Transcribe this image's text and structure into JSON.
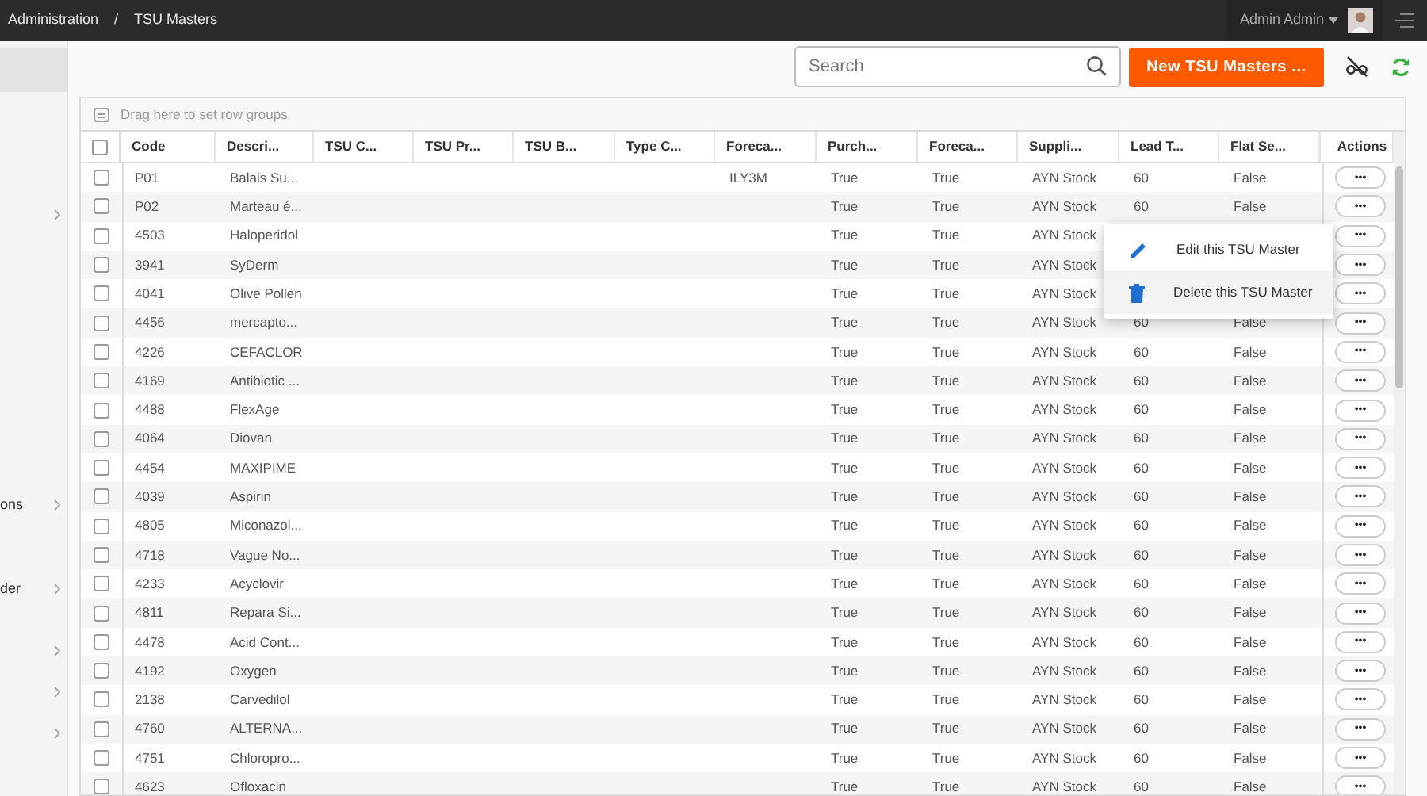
{
  "breadcrumb": [
    "Administration",
    "/",
    "TSU Masters"
  ],
  "user": {
    "name": "Admin Admin"
  },
  "sidebar": {
    "items": [
      {
        "selected": true,
        "expandable": false
      },
      {
        "selected": false,
        "expandable": true
      },
      {
        "label": "ons",
        "selected": false,
        "expandable": true
      },
      {
        "label": "der",
        "selected": false,
        "expandable": true
      },
      {
        "selected": false,
        "expandable": true
      },
      {
        "selected": false,
        "expandable": true
      },
      {
        "selected": false,
        "expandable": true
      }
    ]
  },
  "search": {
    "placeholder": "Search"
  },
  "new_button": "New TSU Masters ...",
  "grid": {
    "group_hint": "Drag here to set row groups",
    "select_all_checked": false,
    "columns": [
      "Code",
      "Descri...",
      "TSU C...",
      "TSU Pr...",
      "TSU B...",
      "Type C...",
      "Foreca...",
      "Purch...",
      "Foreca...",
      "Suppli...",
      "Lead T...",
      "Flat Se...",
      "Actions"
    ],
    "rows": [
      {
        "checked": false,
        "code": "P01",
        "description": "Balais Su...",
        "forecast": "ILY3M",
        "purchase": "True",
        "forecast_2": "True",
        "supplier": "AYN Stock",
        "lead": "60",
        "flat": "False",
        "action": "•••"
      },
      {
        "checked": false,
        "code": "P02",
        "description": "Marteau é...",
        "purchase": "True",
        "forecast_2": "True",
        "supplier": "AYN Stock",
        "lead": "60",
        "flat": "False",
        "action": "•••"
      },
      {
        "checked": false,
        "code": "4503",
        "description": "Haloperidol",
        "purchase": "True",
        "forecast_2": "True",
        "supplier": "AYN Stock",
        "action": "•••"
      },
      {
        "checked": false,
        "code": "3941",
        "description": "SyDerm",
        "purchase": "True",
        "forecast_2": "True",
        "supplier": "AYN Stock",
        "action": "•••"
      },
      {
        "checked": false,
        "code": "4041",
        "description": "Olive Pollen",
        "purchase": "True",
        "forecast_2": "True",
        "supplier": "AYN Stock",
        "action": "•••"
      },
      {
        "checked": false,
        "code": "4456",
        "description": "mercapto...",
        "purchase": "True",
        "forecast_2": "True",
        "supplier": "AYN Stock",
        "lead": "60",
        "flat": "False",
        "action": "•••"
      },
      {
        "checked": false,
        "code": "4226",
        "description": "CEFACLOR",
        "purchase": "True",
        "forecast_2": "True",
        "supplier": "AYN Stock",
        "lead": "60",
        "flat": "False",
        "action": "•••"
      },
      {
        "checked": false,
        "code": "4169",
        "description": "Antibiotic ...",
        "purchase": "True",
        "forecast_2": "True",
        "supplier": "AYN Stock",
        "lead": "60",
        "flat": "False",
        "action": "•••"
      },
      {
        "checked": false,
        "code": "4488",
        "description": "FlexAge",
        "purchase": "True",
        "forecast_2": "True",
        "supplier": "AYN Stock",
        "lead": "60",
        "flat": "False",
        "action": "•••"
      },
      {
        "checked": false,
        "code": "4064",
        "description": "Diovan",
        "purchase": "True",
        "forecast_2": "True",
        "supplier": "AYN Stock",
        "lead": "60",
        "flat": "False",
        "action": "•••"
      },
      {
        "checked": false,
        "code": "4454",
        "description": "MAXIPIME",
        "purchase": "True",
        "forecast_2": "True",
        "supplier": "AYN Stock",
        "lead": "60",
        "flat": "False",
        "action": "•••"
      },
      {
        "checked": false,
        "code": "4039",
        "description": "Aspirin",
        "purchase": "True",
        "forecast_2": "True",
        "supplier": "AYN Stock",
        "lead": "60",
        "flat": "False",
        "action": "•••"
      },
      {
        "checked": false,
        "code": "4805",
        "description": "Miconazol...",
        "purchase": "True",
        "forecast_2": "True",
        "supplier": "AYN Stock",
        "lead": "60",
        "flat": "False",
        "action": "•••"
      },
      {
        "checked": false,
        "code": "4718",
        "description": "Vague No...",
        "purchase": "True",
        "forecast_2": "True",
        "supplier": "AYN Stock",
        "lead": "60",
        "flat": "False",
        "action": "•••"
      },
      {
        "checked": false,
        "code": "4233",
        "description": "Acyclovir",
        "purchase": "True",
        "forecast_2": "True",
        "supplier": "AYN Stock",
        "lead": "60",
        "flat": "False",
        "action": "•••"
      },
      {
        "checked": false,
        "code": "4811",
        "description": "Repara Si...",
        "purchase": "True",
        "forecast_2": "True",
        "supplier": "AYN Stock",
        "lead": "60",
        "flat": "False",
        "action": "•••"
      },
      {
        "checked": false,
        "code": "4478",
        "description": "Acid Cont...",
        "purchase": "True",
        "forecast_2": "True",
        "supplier": "AYN Stock",
        "lead": "60",
        "flat": "False",
        "action": "•••"
      },
      {
        "checked": false,
        "code": "4192",
        "description": "Oxygen",
        "purchase": "True",
        "forecast_2": "True",
        "supplier": "AYN Stock",
        "lead": "60",
        "flat": "False",
        "action": "•••"
      },
      {
        "checked": false,
        "code": "2138",
        "description": "Carvedilol",
        "purchase": "True",
        "forecast_2": "True",
        "supplier": "AYN Stock",
        "lead": "60",
        "flat": "False",
        "action": "•••"
      },
      {
        "checked": false,
        "code": "4760",
        "description": "ALTERNA...",
        "purchase": "True",
        "forecast_2": "True",
        "supplier": "AYN Stock",
        "lead": "60",
        "flat": "False",
        "action": "•••"
      },
      {
        "checked": false,
        "code": "4751",
        "description": "Chloropro...",
        "purchase": "True",
        "forecast_2": "True",
        "supplier": "AYN Stock",
        "lead": "60",
        "flat": "False",
        "action": "•••"
      },
      {
        "checked": false,
        "code": "4623",
        "description": "Ofloxacin",
        "purchase": "True",
        "forecast_2": "True",
        "supplier": "AYN Stock",
        "lead": "60",
        "flat": "False",
        "action": "•••"
      }
    ]
  },
  "context_menu": {
    "items": [
      {
        "kind": "edit",
        "label": "Edit this TSU Master",
        "selected": false
      },
      {
        "kind": "delete",
        "label": "Delete this TSU Master",
        "selected": true
      }
    ]
  }
}
